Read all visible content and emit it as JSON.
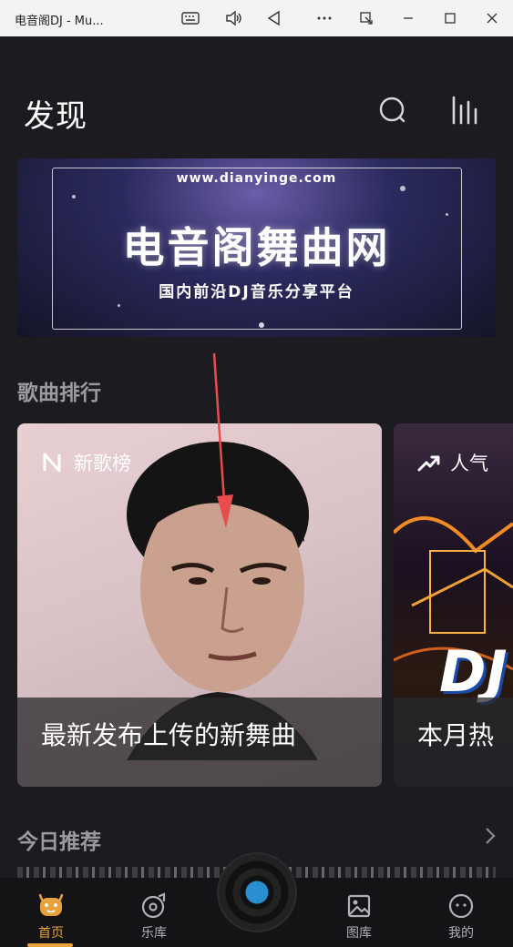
{
  "window": {
    "title": "电音阁DJ - Mu...",
    "icons": [
      "keyboard-icon",
      "volume-icon",
      "back-triangle-icon",
      "more-icon",
      "restore-window-icon",
      "minimize-icon",
      "maximize-icon",
      "close-icon"
    ]
  },
  "header": {
    "title": "发现",
    "icons": [
      "search-icon",
      "equalizer-icon"
    ]
  },
  "banner": {
    "url": "www.dianyinge.com",
    "title": "电音阁舞曲网",
    "subtitle": "国内前沿DJ音乐分享平台"
  },
  "rankings": {
    "section_title": "歌曲排行",
    "cards": [
      {
        "badge": "新歌榜",
        "icon": "new-n-icon",
        "caption": "最新发布上传的新舞曲"
      },
      {
        "badge": "人气",
        "icon": "trend-up-icon",
        "caption": "本月热",
        "art_text": "DJ"
      }
    ]
  },
  "daily": {
    "section_title": "今日推荐",
    "more_icon": "chevron-right-icon"
  },
  "bottom_nav": {
    "items": [
      {
        "label": "首页",
        "icon": "home-face-icon",
        "active": true
      },
      {
        "label": "乐库",
        "icon": "music-library-icon",
        "active": false
      },
      {
        "label": "图库",
        "icon": "gallery-icon",
        "active": false
      },
      {
        "label": "我的",
        "icon": "profile-icon",
        "active": false
      }
    ],
    "player_icon": "vinyl-disc-icon"
  },
  "colors": {
    "background": "#1c1c20",
    "accent": "#e8a23c",
    "muted_text": "#9a9aa0",
    "annotation": "#e84c4c"
  }
}
